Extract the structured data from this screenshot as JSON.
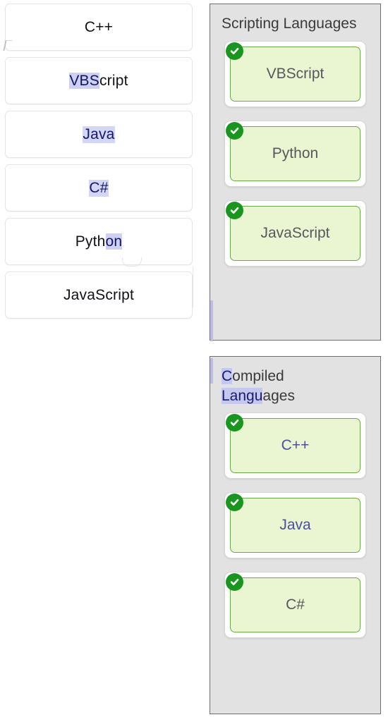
{
  "source_list": {
    "name": "available-languages",
    "items": [
      {
        "label": "C++",
        "selected_prefix": "",
        "selected_rest": "C++"
      },
      {
        "label": "VBScript",
        "selected_prefix": "VBS",
        "selected_rest": "cript"
      },
      {
        "label": "Java",
        "selected_prefix": "",
        "selected_rest": "Java"
      },
      {
        "label": "C#",
        "selected_prefix": "C#",
        "selected_rest": ""
      },
      {
        "label": "Python",
        "selected_prefix": "Pyth",
        "selected_rest": "on"
      },
      {
        "label": "JavaScript",
        "selected_prefix": "",
        "selected_rest": "JavaScript"
      }
    ]
  },
  "panels": [
    {
      "id": "scripting",
      "title": "Scripting Languages",
      "title_selected_part": "",
      "title_rest": "Scripting Languages",
      "cards": [
        {
          "label": "VBScript",
          "checked": true,
          "status_icon": "check-circle-icon",
          "tinted": false
        },
        {
          "label": "Python",
          "checked": true,
          "status_icon": "check-circle-icon",
          "tinted": false
        },
        {
          "label": "JavaScript",
          "checked": true,
          "status_icon": "check-circle-icon",
          "tinted": false
        }
      ]
    },
    {
      "id": "compiled",
      "title": "Compiled Languages",
      "title_line1_sel": "C",
      "title_line1_rest": "ompiled",
      "title_line2_sel": "Langu",
      "title_line2_rest": "ages",
      "cards": [
        {
          "label": "C++",
          "checked": true,
          "status_icon": "check-circle-icon",
          "tinted": true
        },
        {
          "label": "Java",
          "checked": true,
          "status_icon": "check-circle-icon",
          "tinted": true
        },
        {
          "label": "C#",
          "checked": true,
          "status_icon": "check-circle-icon",
          "tinted": false
        }
      ]
    }
  ],
  "colors": {
    "panel_background": "#e2e2e2",
    "panel_border": "#6f6f6f",
    "card_fill": "#eaf5d2",
    "card_border": "#6aa94a",
    "check_badge": "#1a9620",
    "card_text": "#56595b",
    "title_text": "#3a3a3a",
    "selection_highlight": "#c5c8ee",
    "list_item_background": "#ffffff",
    "list_item_border": "#e3e4e6"
  }
}
